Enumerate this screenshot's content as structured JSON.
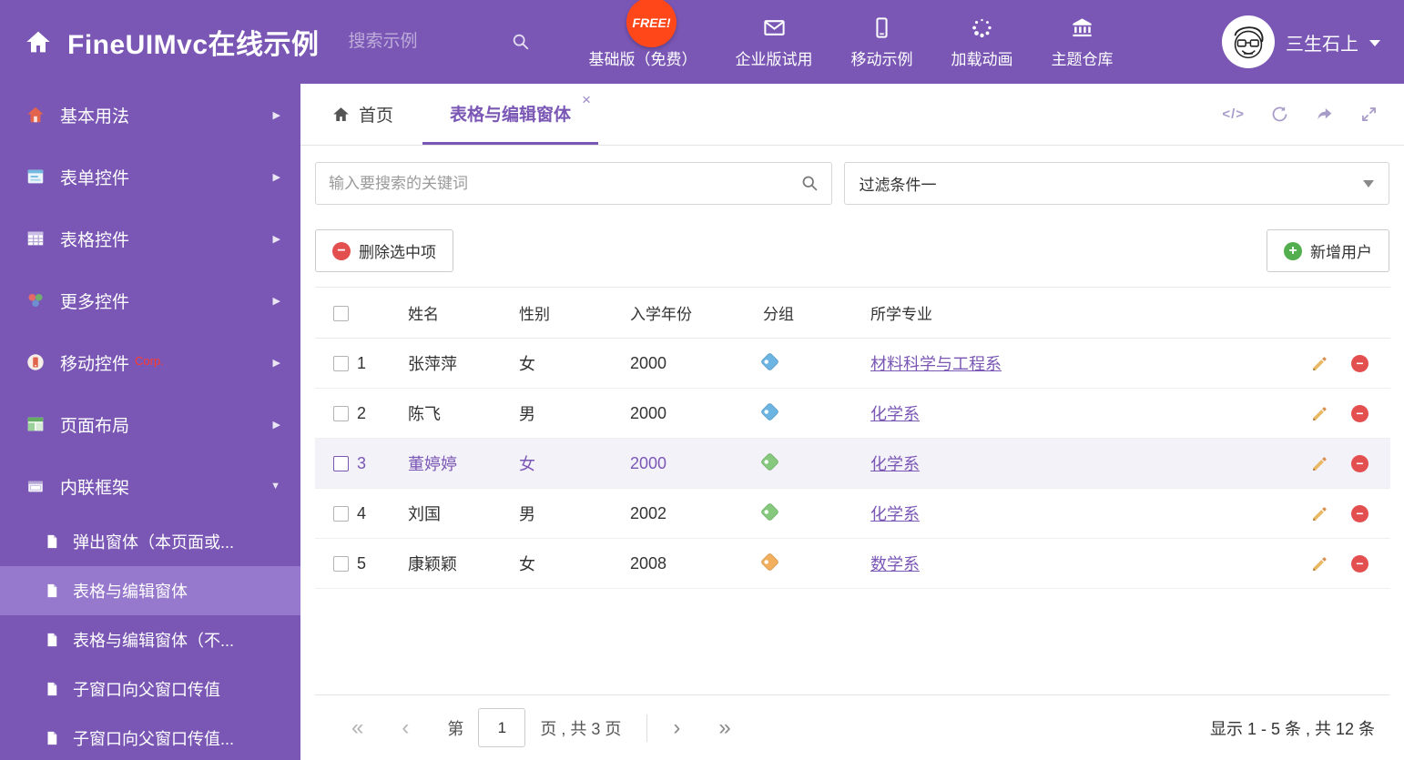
{
  "colors": {
    "primary": "#7a57b5",
    "sidebar_selected": "#9678cc",
    "free_badge_bg": "#ff4719",
    "delete_red": "#e34f4f",
    "add_green": "#52ae4e",
    "selected_row_bg": "#f4f2f9"
  },
  "icons": {
    "close_tab": "×",
    "minus": "−",
    "plus": "+",
    "code": "</>",
    "first": "«",
    "prev": "‹",
    "next": "›",
    "last": "»",
    "caret_right": "▶",
    "caret_down": "▼"
  },
  "header": {
    "title": "FineUIMvc在线示例",
    "search_placeholder": "搜索示例",
    "free_badge": "FREE!",
    "nav": [
      {
        "label": "基础版（免费）",
        "icon": "download"
      },
      {
        "label": "企业版试用",
        "icon": "envelope"
      },
      {
        "label": "移动示例",
        "icon": "mobile"
      },
      {
        "label": "加载动画",
        "icon": "spinner"
      },
      {
        "label": "主题仓库",
        "icon": "bank"
      }
    ],
    "username": "三生石上"
  },
  "sidebar": {
    "items": [
      {
        "label": "基本用法",
        "icon": "home"
      },
      {
        "label": "表单控件",
        "icon": "form"
      },
      {
        "label": "表格控件",
        "icon": "table"
      },
      {
        "label": "更多控件",
        "icon": "widgets"
      },
      {
        "label": "移动控件",
        "icon": "mobilectl",
        "badge": "Corp."
      },
      {
        "label": "页面布局",
        "icon": "layout"
      },
      {
        "label": "内联框架",
        "icon": "frames",
        "expanded": true
      }
    ],
    "subitems": [
      {
        "label": "弹出窗体（本页面或..."
      },
      {
        "label": "表格与编辑窗体",
        "active": true
      },
      {
        "label": "表格与编辑窗体（不..."
      },
      {
        "label": "子窗口向父窗口传值"
      },
      {
        "label": "子窗口向父窗口传值..."
      }
    ]
  },
  "tabs": {
    "home_label": "首页",
    "active_label": "表格与编辑窗体",
    "tools": [
      "code-icon",
      "refresh-icon",
      "share-icon",
      "expand-icon"
    ]
  },
  "filters": {
    "search_placeholder": "输入要搜索的关键词",
    "dropdown_value": "过滤条件一"
  },
  "toolbar": {
    "delete_label": "删除选中项",
    "add_label": "新增用户"
  },
  "grid": {
    "columns": [
      "姓名",
      "性别",
      "入学年份",
      "分组",
      "所学专业"
    ],
    "rows": [
      {
        "index": "1",
        "name": "张萍萍",
        "gender": "女",
        "year": "2000",
        "tag_color": "#6cb5e3",
        "major": "材料科学与工程系",
        "selected": false
      },
      {
        "index": "2",
        "name": "陈飞",
        "gender": "男",
        "year": "2000",
        "tag_color": "#6cb5e3",
        "major": "化学系",
        "selected": false
      },
      {
        "index": "3",
        "name": "董婷婷",
        "gender": "女",
        "year": "2000",
        "tag_color": "#86c97e",
        "major": "化学系",
        "selected": true
      },
      {
        "index": "4",
        "name": "刘国",
        "gender": "男",
        "year": "2002",
        "tag_color": "#86c97e",
        "major": "化学系",
        "selected": false
      },
      {
        "index": "5",
        "name": "康颖颖",
        "gender": "女",
        "year": "2008",
        "tag_color": "#f2b05e",
        "major": "数学系",
        "selected": false
      }
    ]
  },
  "pagination": {
    "page_prefix": "第",
    "page_value": "1",
    "page_suffix": "页 , 共 3 页",
    "summary": "显示 1 - 5 条 , 共 12 条"
  }
}
